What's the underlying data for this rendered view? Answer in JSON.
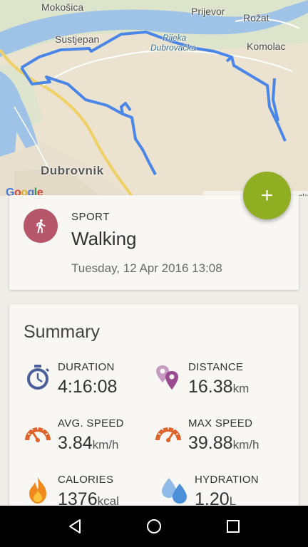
{
  "map": {
    "labels": {
      "mokosica": "Mokošica",
      "prijevor": "Prijevor",
      "rozat": "Rožat",
      "sustjepan": "Sustjepan",
      "rijeka_line1": "Rijeka",
      "rijeka_line2": "Dubrovačka",
      "komolac": "Komolac",
      "dubrovnik": "Dubrovnik"
    },
    "route_color": "#4a86e8",
    "attribution_fragment": "gle"
  },
  "fab": {
    "label": "+",
    "color": "#8fae22"
  },
  "sport": {
    "label": "SPORT",
    "value": "Walking",
    "date": "Tuesday, 12 Apr 2016 13:08",
    "icon": "walking-person-icon",
    "icon_bg": "#b5566b"
  },
  "summary": {
    "title": "Summary",
    "stats": [
      {
        "key": "duration",
        "label": "DURATION",
        "value": "4:16:08",
        "unit": "",
        "icon": "stopwatch-icon",
        "color": "#4a5f9a"
      },
      {
        "key": "distance",
        "label": "DISTANCE",
        "value": "16.38",
        "unit": "km",
        "icon": "map-pins-icon",
        "color": "#9a4a8e"
      },
      {
        "key": "avg_speed",
        "label": "AVG. SPEED",
        "value": "3.84",
        "unit": "km/h",
        "icon": "speedometer-icon",
        "color": "#e0632a"
      },
      {
        "key": "max_speed",
        "label": "MAX SPEED",
        "value": "39.88",
        "unit": "km/h",
        "icon": "speedometer-icon",
        "color": "#e0632a"
      },
      {
        "key": "calories",
        "label": "CALORIES",
        "value": "1376",
        "unit": "kcal",
        "icon": "flame-icon",
        "color": "#f08a1d"
      },
      {
        "key": "hydration",
        "label": "HYDRATION",
        "value": "1.20",
        "unit": "L",
        "icon": "water-drops-icon",
        "color": "#4a8fd8"
      }
    ]
  },
  "navbar": {
    "back": "back-icon",
    "home": "home-icon",
    "recents": "recents-icon"
  }
}
